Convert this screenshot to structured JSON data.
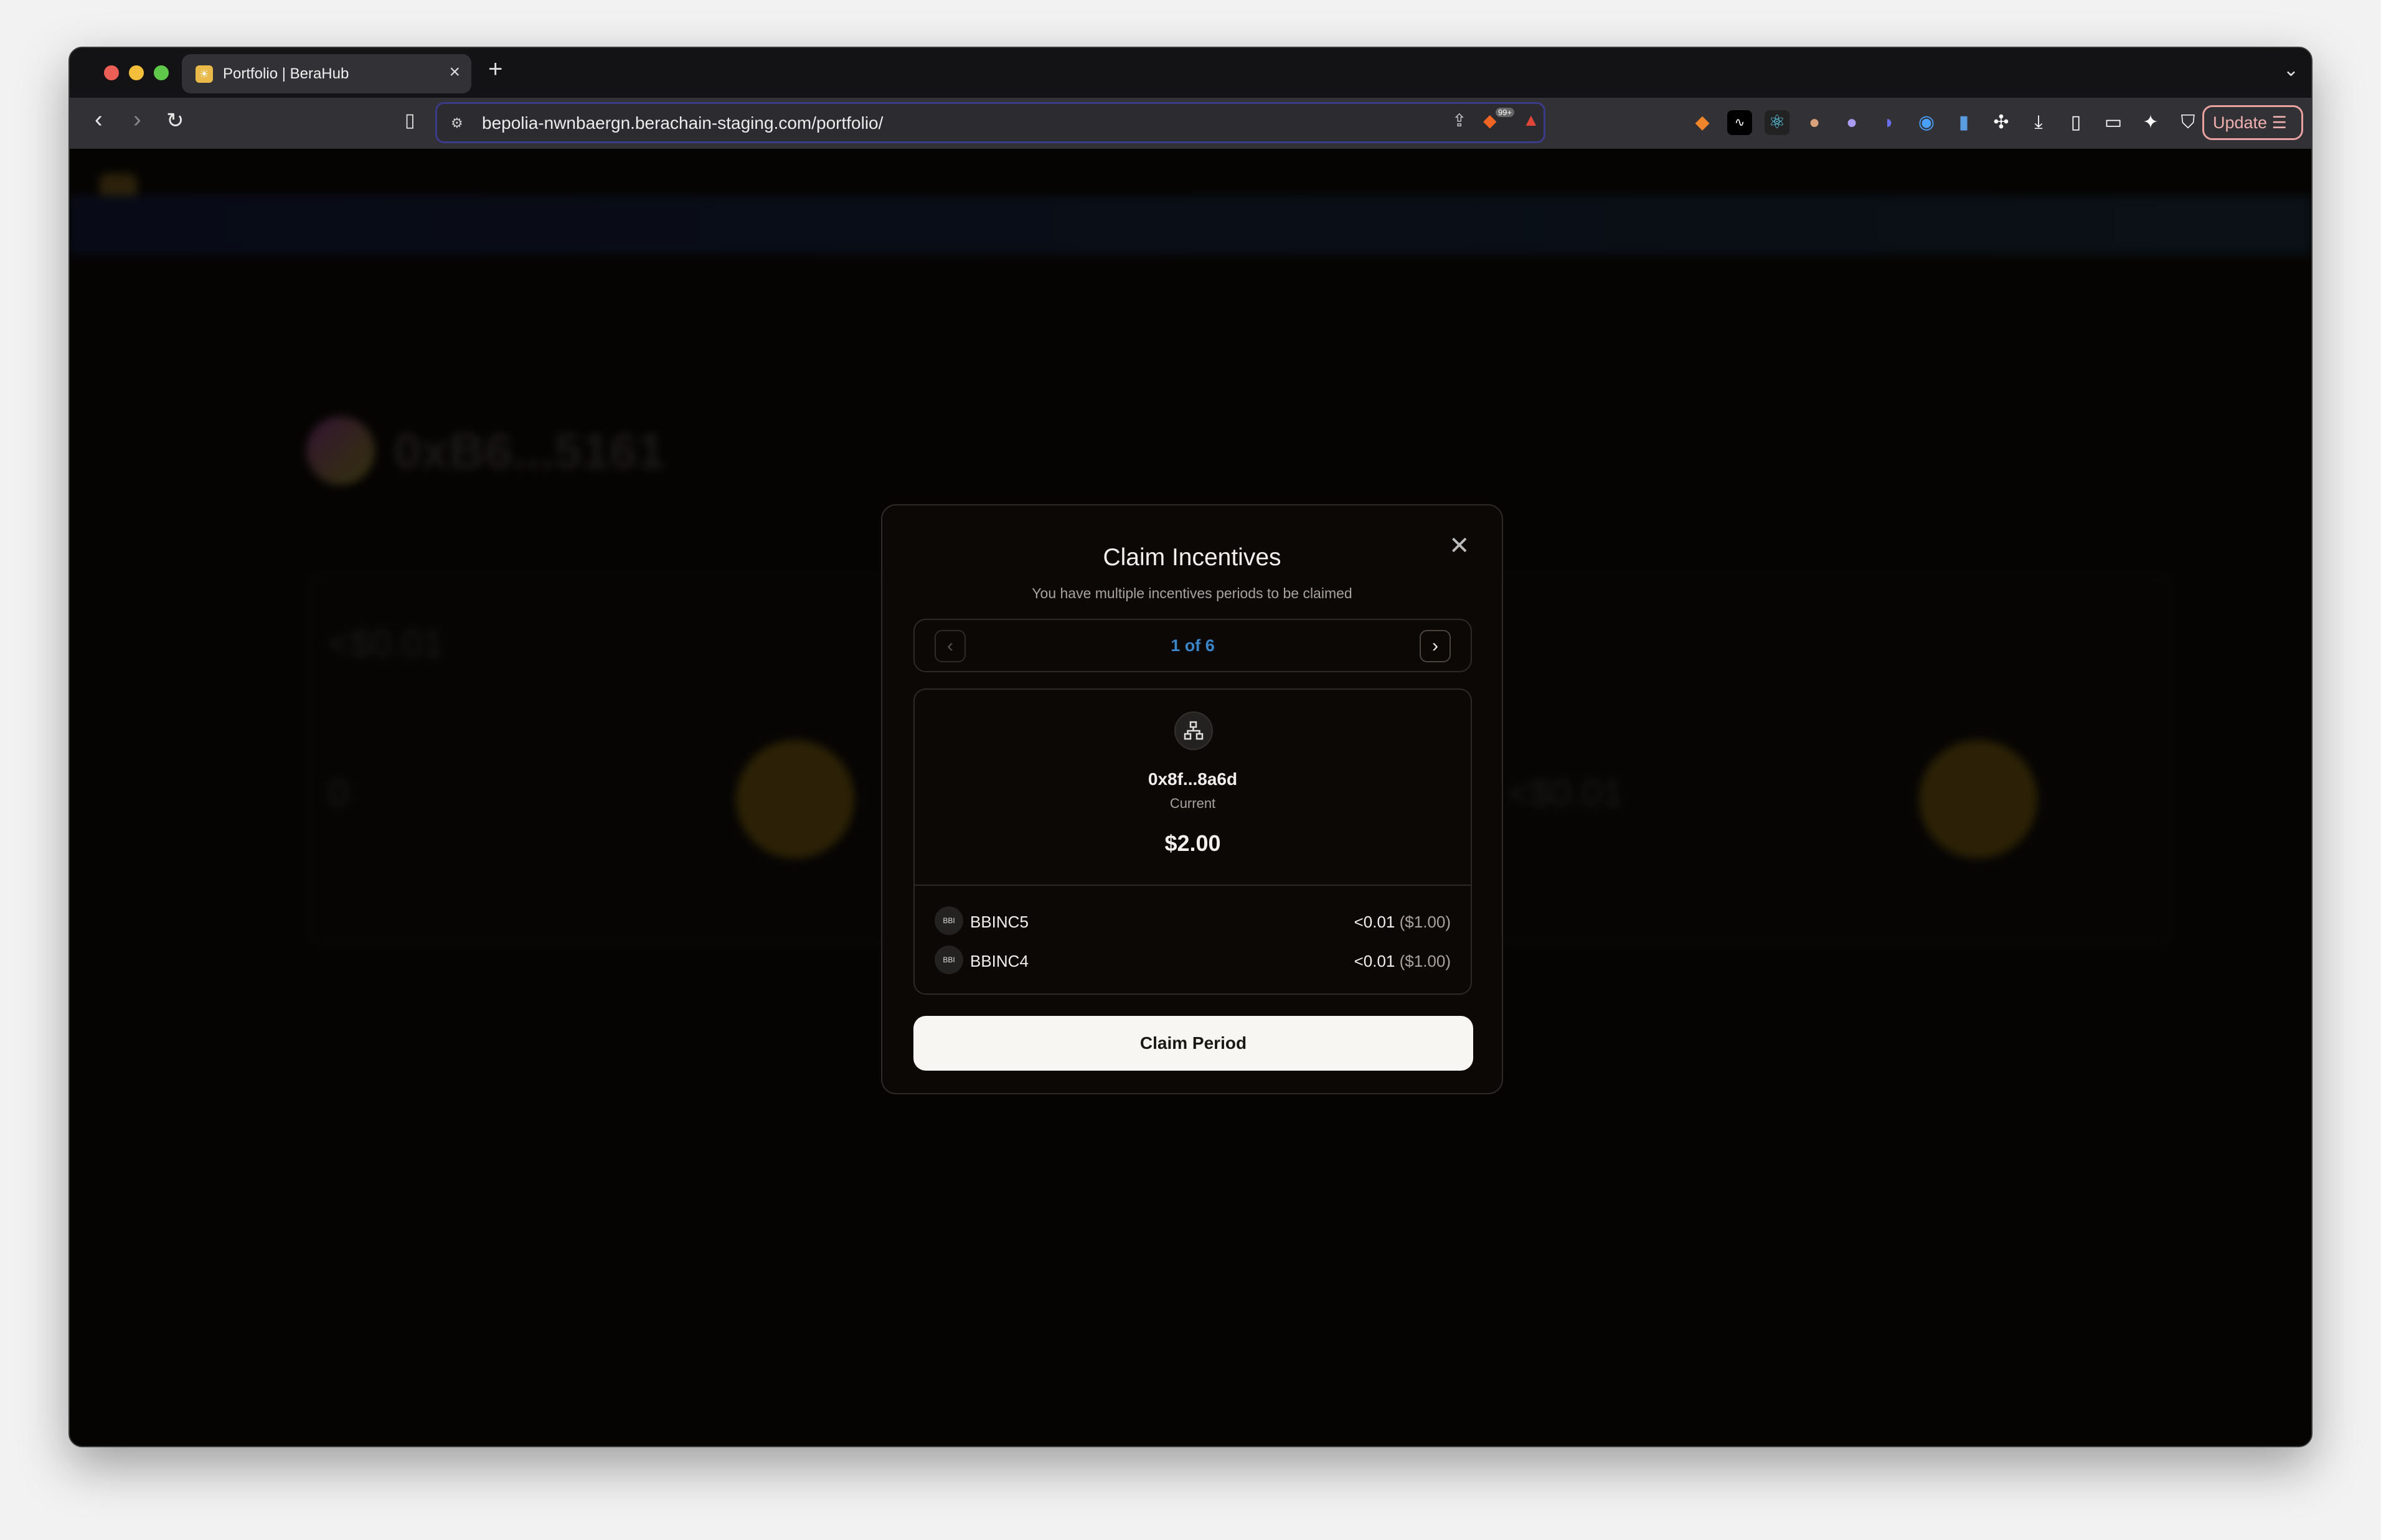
{
  "browser": {
    "tab_title": "Portfolio | BeraHub",
    "url": "bepolia-nwnbaergn.berachain-staging.com/portfolio/",
    "brave_badge": "99+",
    "update_label": "Update",
    "extensions": [
      "metamask-icon",
      "waveform-icon",
      "react-devtools-icon",
      "avatar-extension-icon",
      "ghost-extension-icon",
      "bird-extension-icon",
      "password-lock-icon",
      "ghostery-icon",
      "puzzle-icon",
      "download-icon",
      "sidebar-icon",
      "wallet-icon",
      "sparkle-icon",
      "vpn-shield-icon"
    ]
  },
  "background": {
    "account": "0xB6...5161",
    "total_value": "<$0.01",
    "bgt_value": "0",
    "incentives_value": "<$0.01"
  },
  "modal": {
    "title": "Claim Incentives",
    "subtitle": "You have multiple incentives periods to be claimed",
    "pager": "1 of 6",
    "address": "0x8f...8a6d",
    "status": "Current",
    "amount": "$2.00",
    "tokens": [
      {
        "icon_label": "BBI",
        "name": "BBINC5",
        "amount": "<0.01",
        "usd": "($1.00)"
      },
      {
        "icon_label": "BBI",
        "name": "BBINC4",
        "amount": "<0.01",
        "usd": "($1.00)"
      }
    ],
    "claim_label": "Claim Period"
  }
}
